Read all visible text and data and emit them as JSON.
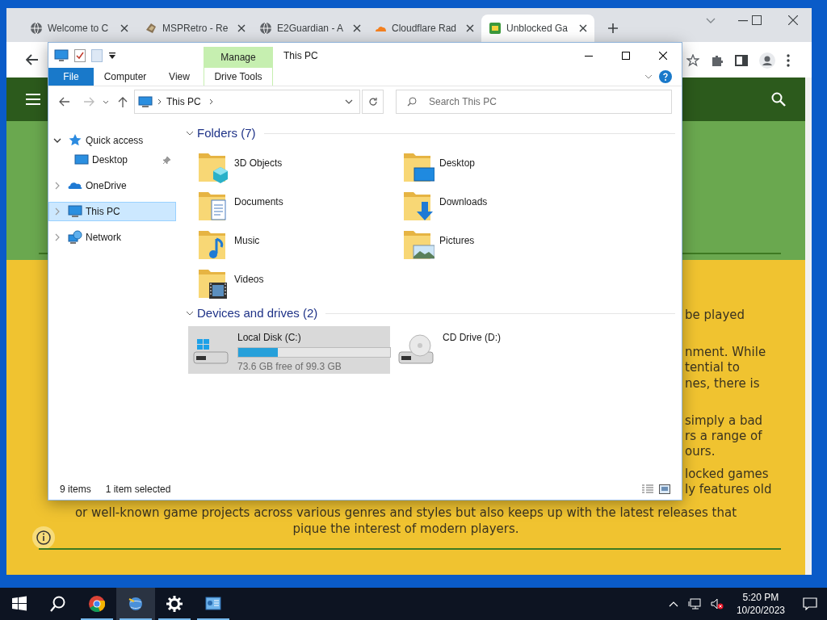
{
  "browser": {
    "tabs": [
      {
        "title": "Welcome to C",
        "kind": "globe",
        "selected": false
      },
      {
        "title": "MSPRetro - Re",
        "kind": "retro",
        "selected": false
      },
      {
        "title": "E2Guardian - A",
        "kind": "globe",
        "selected": false
      },
      {
        "title": "Cloudflare Rad",
        "kind": "cloudflare",
        "selected": false
      },
      {
        "title": "Unblocked Ga",
        "kind": "game",
        "selected": true
      }
    ]
  },
  "web_page": {
    "side_fragments": [
      "be played",
      "nment. While",
      "tential to",
      "nes, there is",
      "simply a bad",
      "rs a range of",
      "ours.",
      "locked games",
      "ly features old"
    ],
    "centered_lines": [
      "or well-known game projects across various genres and styles but also keeps up with the latest releases that",
      "pique the interest of modern players."
    ]
  },
  "explorer": {
    "title": "This PC",
    "context_tab": "Manage",
    "ribbon_tabs": [
      {
        "label": "File",
        "kind": "file"
      },
      {
        "label": "Computer",
        "kind": "tab"
      },
      {
        "label": "View",
        "kind": "tab"
      },
      {
        "label": "Drive Tools",
        "kind": "context"
      }
    ],
    "address": [
      "This PC"
    ],
    "search_placeholder": "Search This PC",
    "nav": [
      {
        "label": "Quick access",
        "kind": "star",
        "expanded": true,
        "selected": false,
        "children": [
          {
            "label": "Desktop",
            "kind": "desktop",
            "pinned": true,
            "selected": false
          }
        ]
      },
      {
        "label": "OneDrive",
        "kind": "cloud",
        "expanded": false,
        "selected": false
      },
      {
        "label": "This PC",
        "kind": "pc",
        "expanded": false,
        "selected": true
      },
      {
        "label": "Network",
        "kind": "network",
        "expanded": false,
        "selected": false
      }
    ],
    "groups": [
      {
        "title": "Folders (7)",
        "expanded": true,
        "items": [
          {
            "name": "3D Objects",
            "kind": "cube",
            "selected": false
          },
          {
            "name": "Desktop",
            "kind": "desktop",
            "selected": false
          },
          {
            "name": "Documents",
            "kind": "documents",
            "selected": false
          },
          {
            "name": "Downloads",
            "kind": "downloads",
            "selected": false
          },
          {
            "name": "Music",
            "kind": "music",
            "selected": false
          },
          {
            "name": "Pictures",
            "kind": "pictures",
            "selected": false
          },
          {
            "name": "Videos",
            "kind": "videos",
            "selected": false
          }
        ]
      },
      {
        "title": "Devices and drives (2)",
        "expanded": true,
        "items": [
          {
            "name": "Local Disk (C:)",
            "kind": "disk",
            "selected": true,
            "level": 0.26,
            "detail": "73.6 GB free of 99.3 GB"
          },
          {
            "name": "CD Drive (D:)",
            "kind": "cd",
            "selected": false
          }
        ]
      }
    ],
    "status": [
      "9 items",
      "1 item selected"
    ]
  },
  "taskbar": {
    "apps": [
      {
        "kind": "start",
        "running": false,
        "active": false
      },
      {
        "kind": "search",
        "running": false,
        "active": false
      },
      {
        "kind": "chrome",
        "running": true,
        "active": false
      },
      {
        "kind": "explorer",
        "running": true,
        "active": true
      },
      {
        "kind": "settings",
        "running": true,
        "active": false
      },
      {
        "kind": "control-panel",
        "running": true,
        "active": false
      }
    ],
    "time": "5:20 PM",
    "date": "10/20/2023"
  }
}
